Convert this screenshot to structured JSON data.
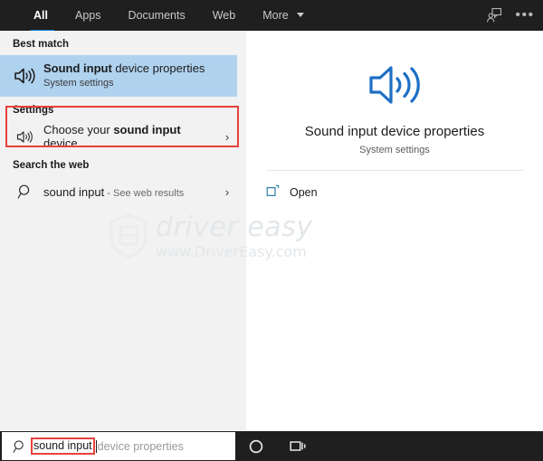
{
  "header": {
    "tabs": [
      {
        "label": "All",
        "active": true
      },
      {
        "label": "Apps",
        "active": false
      },
      {
        "label": "Documents",
        "active": false
      },
      {
        "label": "Web",
        "active": false
      },
      {
        "label": "More",
        "active": false,
        "has_caret": true
      }
    ],
    "feedback_icon": "feedback-person-icon",
    "more_options_icon": "ellipsis-icon",
    "ellipsis_glyph": "•••"
  },
  "left_pane": {
    "best_match": {
      "section_label": "Best match",
      "icon": "speaker-sound-icon",
      "title_bold": "Sound input",
      "title_rest": " device properties",
      "subtitle": "System settings",
      "highlight_color": "#afd2ef",
      "annotation_color": "#e8413c"
    },
    "settings": {
      "section_label": "Settings",
      "items": [
        {
          "icon": "speaker-small-icon",
          "label_pre": "Choose your ",
          "label_bold": "sound input",
          "label_post": " device",
          "chevron": "›"
        }
      ]
    },
    "search_the_web": {
      "section_label": "Search the web",
      "items": [
        {
          "icon": "search-icon",
          "query": "sound input",
          "suffix": " - See web results",
          "chevron": "›"
        }
      ]
    }
  },
  "right_pane": {
    "icon": "speaker-sound-icon-large",
    "icon_color": "#1d6fc4",
    "title": "Sound input device properties",
    "subtitle": "System settings",
    "actions": [
      {
        "icon": "open-external-icon",
        "label": "Open"
      }
    ]
  },
  "watermark": {
    "logo_icon": "driver-easy-logo",
    "title": "driver easy",
    "subtitle": "www.DriverEasy.com"
  },
  "taskbar": {
    "search": {
      "icon": "search-icon",
      "typed_value": "sound input",
      "autocomplete_suffix": "device properties",
      "annotation_color": "#e8413c"
    },
    "cortana_icon": "cortana-circle-icon",
    "task_view_icon": "task-view-icon"
  }
}
